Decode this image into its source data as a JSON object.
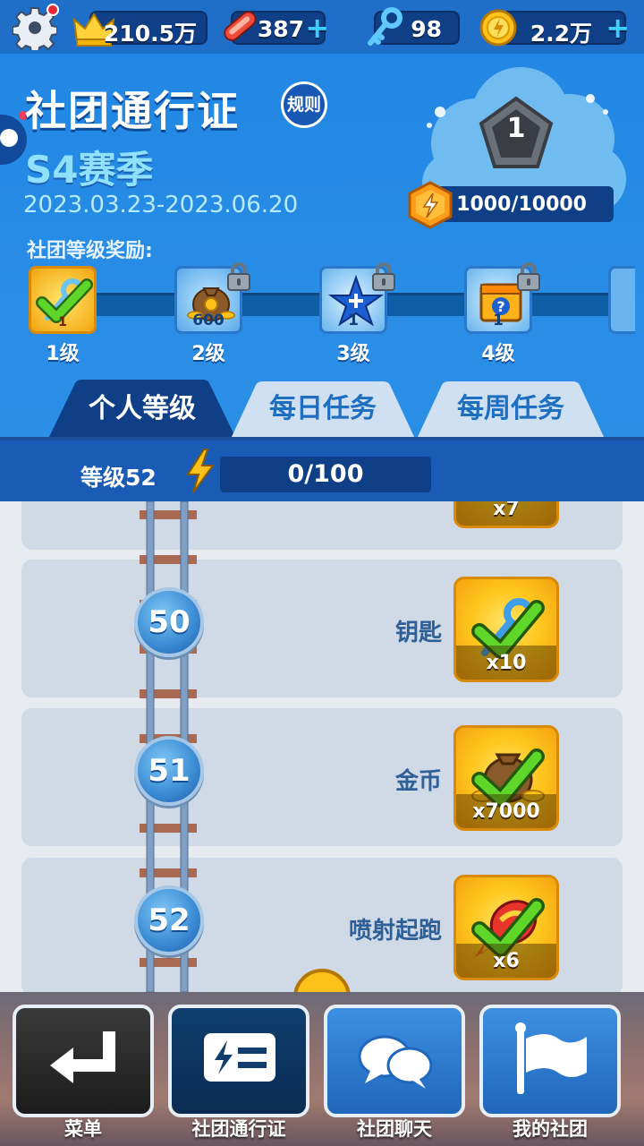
{
  "topbar": {
    "settings_icon": "gear-icon",
    "crown_value": "210.5万",
    "hoverboard_value": "387",
    "keys_value": "98",
    "coins_value": "2.2万",
    "plus_symbol": "+"
  },
  "header": {
    "title": "社团通行证",
    "rules_label": "规则",
    "season": "S4赛季",
    "dates": "2023.03.23-2023.06.20",
    "tier_number": "1",
    "xp_progress": "1000/10000",
    "reward_section_label": "社团等级奖励:"
  },
  "club_rewards": [
    {
      "count": "1",
      "level_label": "1级",
      "icon": "key-icon",
      "claimed": true,
      "locked": false
    },
    {
      "count": "600",
      "level_label": "2级",
      "icon": "coin-bag-icon",
      "claimed": false,
      "locked": true
    },
    {
      "count": "1",
      "level_label": "3级",
      "icon": "star-icon",
      "claimed": false,
      "locked": true
    },
    {
      "count": "1",
      "level_label": "4级",
      "icon": "mystery-box-icon",
      "claimed": false,
      "locked": true
    }
  ],
  "tabs": [
    {
      "label": "个人等级",
      "active": true
    },
    {
      "label": "每日任务",
      "active": false
    },
    {
      "label": "每周任务",
      "active": false
    }
  ],
  "level": {
    "label": "等级52",
    "progress_text": "0/100",
    "progress_fraction": 0
  },
  "rows": [
    {
      "level": "",
      "name": "",
      "qty": "x7",
      "icon": "partial-reward-icon"
    },
    {
      "level": "50",
      "name": "钥匙",
      "qty": "x10",
      "icon": "key-icon"
    },
    {
      "level": "51",
      "name": "金币",
      "qty": "x7000",
      "icon": "coin-bag-icon"
    },
    {
      "level": "52",
      "name": "喷射起跑",
      "qty": "x6",
      "icon": "headstart-icon"
    }
  ],
  "nav": [
    {
      "label": "菜单",
      "icon": "back-arrow-icon"
    },
    {
      "label": "社团通行证",
      "icon": "pass-icon"
    },
    {
      "label": "社团聊天",
      "icon": "chat-icon"
    },
    {
      "label": "我的社团",
      "icon": "flag-icon"
    }
  ],
  "colors": {
    "header_blue": "#2187e4",
    "dark_blue": "#0f3f86",
    "reward_gold": "#ffc71f",
    "check_green": "#3ec81e",
    "list_bg": "#cfdae6"
  }
}
